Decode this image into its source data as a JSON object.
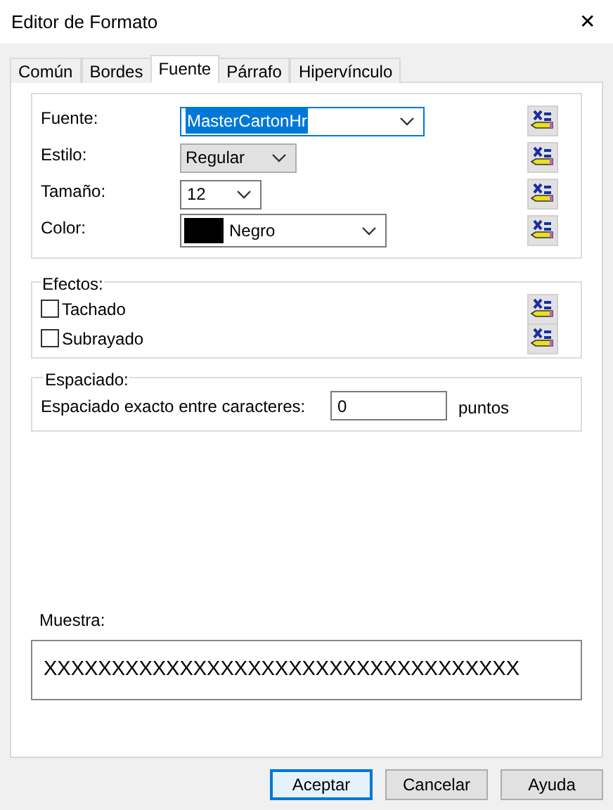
{
  "window": {
    "title": "Editor de Formato",
    "close": "✕"
  },
  "tabs": [
    {
      "label": "Común",
      "selected": false
    },
    {
      "label": "Bordes",
      "selected": false
    },
    {
      "label": "Fuente",
      "selected": true
    },
    {
      "label": "Párrafo",
      "selected": false
    },
    {
      "label": "Hipervínculo",
      "selected": false
    }
  ],
  "font_group": {
    "rows": [
      {
        "label": "Fuente:",
        "kind": "editable",
        "value": "MasterCartonHr",
        "highlighted": true
      },
      {
        "label": "Estilo:",
        "kind": "list",
        "value": "Regular"
      },
      {
        "label": "Tamaño:",
        "kind": "editable",
        "value": "12",
        "highlighted": false
      },
      {
        "label": "Color:",
        "kind": "color",
        "value": "Negro",
        "color": "#000000"
      }
    ]
  },
  "effects": {
    "title": "Efectos:",
    "items": [
      {
        "label": "Tachado",
        "checked": false
      },
      {
        "label": "Subrayado",
        "checked": false
      }
    ]
  },
  "spacing": {
    "title": "Espaciado:",
    "label": "Espaciado exacto entre caracteres:",
    "value": "0",
    "unit": "puntos"
  },
  "sample": {
    "label": "Muestra:",
    "text": "XXXXXXXXXXXXXXXXXXXXXXXXXXXXXXXXXXX"
  },
  "buttons": [
    {
      "label": "Aceptar",
      "default": true
    },
    {
      "label": "Cancelar",
      "default": false
    },
    {
      "label": "Ayuda",
      "default": false
    }
  ]
}
